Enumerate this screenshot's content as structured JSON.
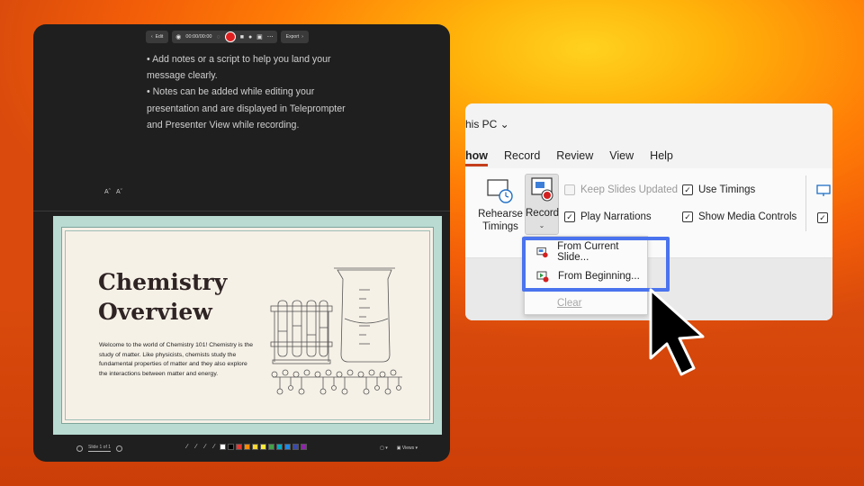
{
  "colors": {
    "record_red": "#e02020",
    "highlight_blue": "#4a73ee",
    "slide_mint": "#b9dbd2",
    "window_dark": "#1f1f1f"
  },
  "recorder": {
    "toolbar": {
      "edit_label": "Edit",
      "timer": "00:00/00:00",
      "export_label": "Export"
    },
    "notes": [
      "• Add notes or a script to help you land your message clearly.",
      "• Notes can be added while editing your presentation and are displayed in Teleprompter and Presenter View while recording."
    ],
    "font_buttons": [
      "Aˆ",
      "Aˇ"
    ],
    "slide": {
      "title": "Chemistry\nOverview",
      "body": "Welcome to the world of Chemistry 101! Chemistry is the study of matter. Like physicists, chemists study the fundamental properties of matter and they also explore the interactions between matter and energy."
    },
    "bottom_bar": {
      "slide_counter": "Slide 1 of 1",
      "views_label": "Views",
      "swatches": [
        "#ffffff",
        "#000000",
        "#e53935",
        "#fb8c00",
        "#fdd835",
        "#ffeb3b",
        "#43a047",
        "#00acc1",
        "#1e88e5",
        "#3949ab",
        "#8e24aa"
      ]
    }
  },
  "ribbon": {
    "save_location": "his PC ⌄",
    "tabs": [
      "how",
      "Record",
      "Review",
      "View",
      "Help"
    ],
    "rehearse_label": "Rehearse Timings",
    "record_label": "Record",
    "checkboxes": [
      {
        "label": "Keep Slides Updated",
        "checked": false,
        "disabled": true
      },
      {
        "label": "Play Narrations",
        "checked": true,
        "disabled": false
      },
      {
        "label": "Use Timings",
        "checked": true,
        "disabled": false
      },
      {
        "label": "Show Media Controls",
        "checked": true,
        "disabled": false
      }
    ],
    "record_menu": {
      "from_current": "From Current Slide...",
      "from_beginning": "From Beginning...",
      "clear": "Clear"
    }
  }
}
